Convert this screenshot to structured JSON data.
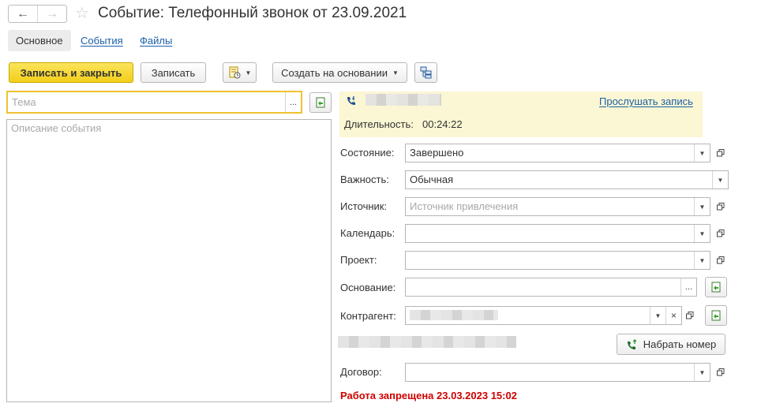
{
  "window": {
    "title": "Событие: Телефонный звонок от 23.09.2021"
  },
  "tabs": [
    {
      "label": "Основное"
    },
    {
      "label": "События"
    },
    {
      "label": "Файлы"
    }
  ],
  "toolbar": {
    "save_close_label": "Записать и закрыть",
    "save_label": "Записать",
    "create_based_label": "Создать на основании"
  },
  "left": {
    "subject_placeholder": "Тема",
    "subject_choice": "...",
    "description_placeholder": "Описание события"
  },
  "call": {
    "listen_label": "Прослушать запись",
    "duration_label": "Длительность:",
    "duration_value": "00:24:22"
  },
  "fields": {
    "state": {
      "label": "Состояние:",
      "value": "Завершено"
    },
    "importance": {
      "label": "Важность:",
      "value": "Обычная"
    },
    "source": {
      "label": "Источник:",
      "placeholder": "Источник привлечения"
    },
    "calendar": {
      "label": "Календарь:",
      "value": ""
    },
    "project": {
      "label": "Проект:",
      "value": ""
    },
    "basis": {
      "label": "Основание:",
      "value": "",
      "choice": "..."
    },
    "counterparty": {
      "label": "Контрагент:",
      "clear": "×"
    },
    "contract": {
      "label": "Договор:",
      "value": ""
    }
  },
  "dial_button_label": "Набрать номер",
  "warning": "Работа запрещена 23.03.2023 15:02",
  "colors": {
    "primary_button": "#f2cf1a",
    "focus_border": "#f0c232",
    "link": "#1c5fa8",
    "warning": "#d00000",
    "call_panel": "#fbf6d3"
  },
  "icons": [
    "back-arrow-icon",
    "forward-arrow-icon",
    "star-icon",
    "report-icon",
    "structure-icon",
    "phone-icon",
    "open-icon",
    "create-new-icon",
    "phone-dial-icon",
    "dropdown-icon"
  ]
}
